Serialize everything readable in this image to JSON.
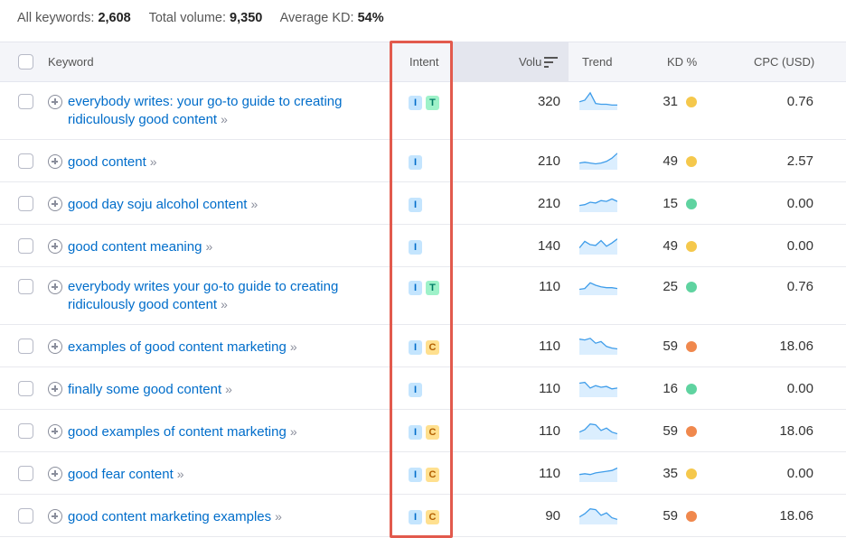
{
  "summary": {
    "all_keywords_label": "All keywords:",
    "all_keywords_value": "2,608",
    "total_volume_label": "Total volume:",
    "total_volume_value": "9,350",
    "avg_kd_label": "Average KD:",
    "avg_kd_value": "54%"
  },
  "columns": {
    "keyword": "Keyword",
    "intent": "Intent",
    "volume": "Volu",
    "trend": "Trend",
    "kd": "KD %",
    "cpc": "CPC (USD)"
  },
  "colors": {
    "link": "#006dca",
    "kd_easy": "#5fd3a0",
    "kd_possible": "#f5c84c",
    "kd_difficult": "#f0884d",
    "highlight": "#e25a4d"
  },
  "rows": [
    {
      "keyword_line1": "everybody writes: your go-to guide to creating",
      "keyword_line2": "ridiculously good content",
      "intents": [
        "I",
        "T"
      ],
      "volume": "320",
      "trend": [
        0.4,
        0.5,
        0.95,
        0.3,
        0.25,
        0.25,
        0.2,
        0.2
      ],
      "kd": "31",
      "kd_color": "#f5c84c",
      "cpc": "0.76"
    },
    {
      "keyword_line1": "good content",
      "keyword_line2": "",
      "intents": [
        "I"
      ],
      "volume": "210",
      "trend": [
        0.3,
        0.35,
        0.3,
        0.25,
        0.3,
        0.4,
        0.6,
        0.9
      ],
      "kd": "49",
      "kd_color": "#f5c84c",
      "cpc": "2.57"
    },
    {
      "keyword_line1": "good day soju alcohol content",
      "keyword_line2": "",
      "intents": [
        "I"
      ],
      "volume": "210",
      "trend": [
        0.3,
        0.35,
        0.5,
        0.45,
        0.6,
        0.55,
        0.7,
        0.55
      ],
      "kd": "15",
      "kd_color": "#5fd3a0",
      "cpc": "0.00"
    },
    {
      "keyword_line1": "good content meaning",
      "keyword_line2": "",
      "intents": [
        "I"
      ],
      "volume": "140",
      "trend": [
        0.3,
        0.7,
        0.5,
        0.45,
        0.75,
        0.4,
        0.6,
        0.85
      ],
      "kd": "49",
      "kd_color": "#f5c84c",
      "cpc": "0.00"
    },
    {
      "keyword_line1": "everybody writes your go-to guide to creating",
      "keyword_line2": "ridiculously good content",
      "intents": [
        "I",
        "T"
      ],
      "volume": "110",
      "trend": [
        0.25,
        0.3,
        0.65,
        0.5,
        0.4,
        0.35,
        0.35,
        0.3
      ],
      "kd": "25",
      "kd_color": "#5fd3a0",
      "cpc": "0.76"
    },
    {
      "keyword_line1": "examples of good content marketing",
      "keyword_line2": "",
      "intents": [
        "I",
        "C"
      ],
      "volume": "110",
      "trend": [
        0.85,
        0.8,
        0.9,
        0.6,
        0.7,
        0.4,
        0.3,
        0.25
      ],
      "kd": "59",
      "kd_color": "#f0884d",
      "cpc": "18.06"
    },
    {
      "keyword_line1": "finally some good content",
      "keyword_line2": "",
      "intents": [
        "I"
      ],
      "volume": "110",
      "trend": [
        0.75,
        0.8,
        0.45,
        0.6,
        0.5,
        0.55,
        0.4,
        0.45
      ],
      "kd": "16",
      "kd_color": "#5fd3a0",
      "cpc": "0.00"
    },
    {
      "keyword_line1": "good examples of content marketing",
      "keyword_line2": "",
      "intents": [
        "I",
        "C"
      ],
      "volume": "110",
      "trend": [
        0.35,
        0.5,
        0.85,
        0.8,
        0.45,
        0.6,
        0.35,
        0.25
      ],
      "kd": "59",
      "kd_color": "#f0884d",
      "cpc": "18.06"
    },
    {
      "keyword_line1": "good fear content",
      "keyword_line2": "",
      "intents": [
        "I",
        "C"
      ],
      "volume": "110",
      "trend": [
        0.35,
        0.4,
        0.35,
        0.45,
        0.5,
        0.55,
        0.6,
        0.75
      ],
      "kd": "35",
      "kd_color": "#f5c84c",
      "cpc": "0.00"
    },
    {
      "keyword_line1": "good content marketing examples",
      "keyword_line2": "",
      "intents": [
        "I",
        "C"
      ],
      "volume": "90",
      "trend": [
        0.35,
        0.55,
        0.85,
        0.8,
        0.45,
        0.6,
        0.3,
        0.2
      ],
      "kd": "59",
      "kd_color": "#f0884d",
      "cpc": "18.06"
    }
  ]
}
